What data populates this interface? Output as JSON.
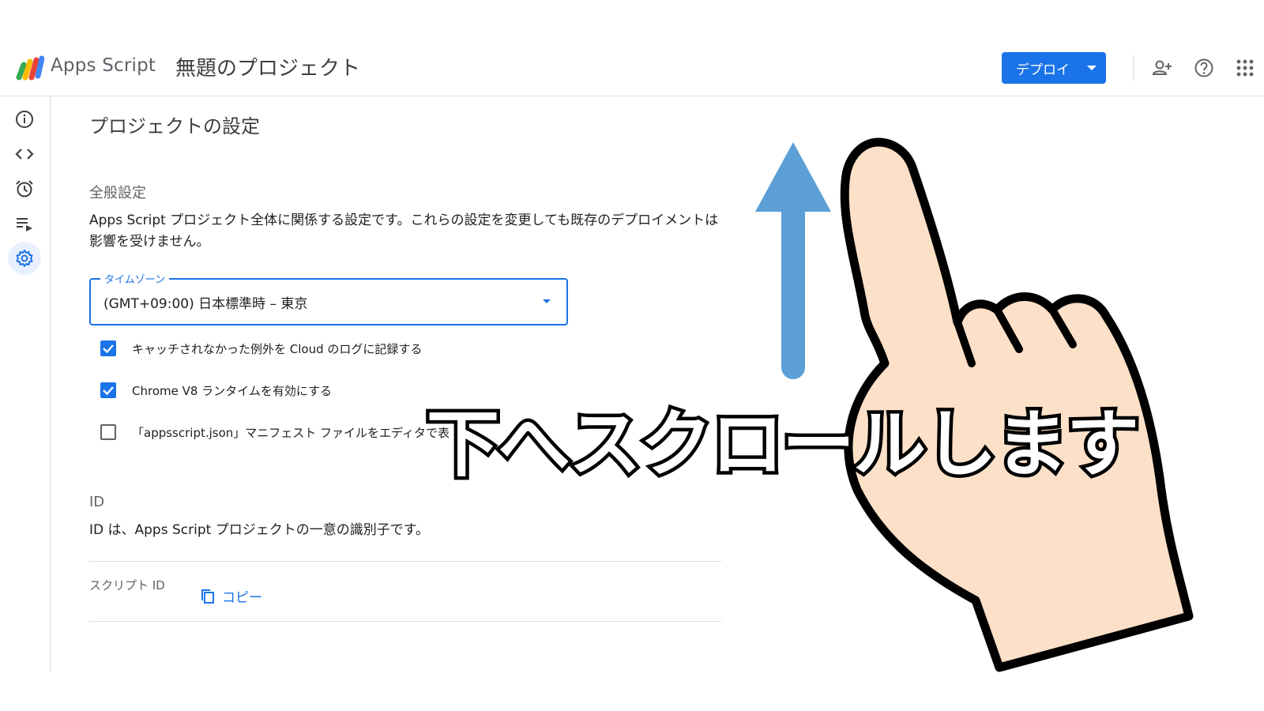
{
  "header": {
    "brand": "Apps Script",
    "project_title": "無題のプロジェクト",
    "deploy_label": "デプロイ",
    "icons": [
      "add-person-icon",
      "help-icon",
      "apps-grid-icon"
    ],
    "accent": "#1a73e8"
  },
  "sidebar": {
    "items": [
      {
        "icon": "info-icon"
      },
      {
        "icon": "code-icon"
      },
      {
        "icon": "alarm-icon"
      },
      {
        "icon": "executions-icon"
      },
      {
        "icon": "gear-icon",
        "active": true
      }
    ]
  },
  "settings": {
    "page_title": "プロジェクトの設定",
    "general": {
      "heading": "全般設定",
      "description": "Apps Script プロジェクト全体に関係する設定です。これらの設定を変更しても既存のデプロイメントは影響を受けません。",
      "timezone_label": "タイムゾーン",
      "timezone_value": "(GMT+09:00) 日本標準時 – 東京",
      "checkboxes": [
        {
          "label": "キャッチされなかった例外を Cloud のログに記録する",
          "checked": true
        },
        {
          "label": "Chrome V8 ランタイムを有効にする",
          "checked": true
        },
        {
          "label": "「appsscript.json」マニフェスト ファイルをエディタで表",
          "checked": false
        }
      ]
    },
    "id_section": {
      "heading": "ID",
      "description": "ID は、Apps Script プロジェクトの一意の識別子です。",
      "script_id_label": "スクリプト ID",
      "copy_label": "コピー"
    }
  },
  "overlay": {
    "caption": "下へスクロールします",
    "arrow_color": "#5b9fd6",
    "hand_color": "#fde0c8"
  }
}
